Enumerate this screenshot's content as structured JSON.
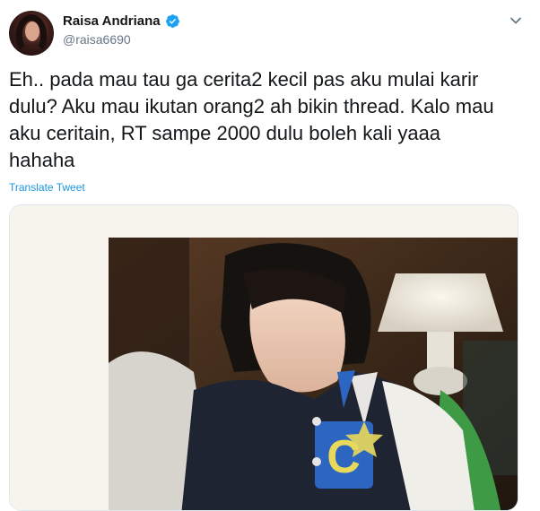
{
  "tweet": {
    "author_name": "Raisa Andriana",
    "handle": "@raisa6690",
    "text": "Eh.. pada mau tau ga cerita2 kecil pas aku mulai karir\ndulu? Aku mau ikutan orang2 ah bikin thread. Kalo mau\naku ceritain, RT sampe 2000 dulu boleh kali yaaa\nhahaha",
    "translate_label": "Translate Tweet"
  },
  "icons": {
    "verified": "verified-badge-icon",
    "menu": "chevron-down-icon"
  },
  "colors": {
    "text": "#14171a",
    "secondary": "#657786",
    "link": "#1b95e0",
    "verified": "#1da1f2"
  }
}
